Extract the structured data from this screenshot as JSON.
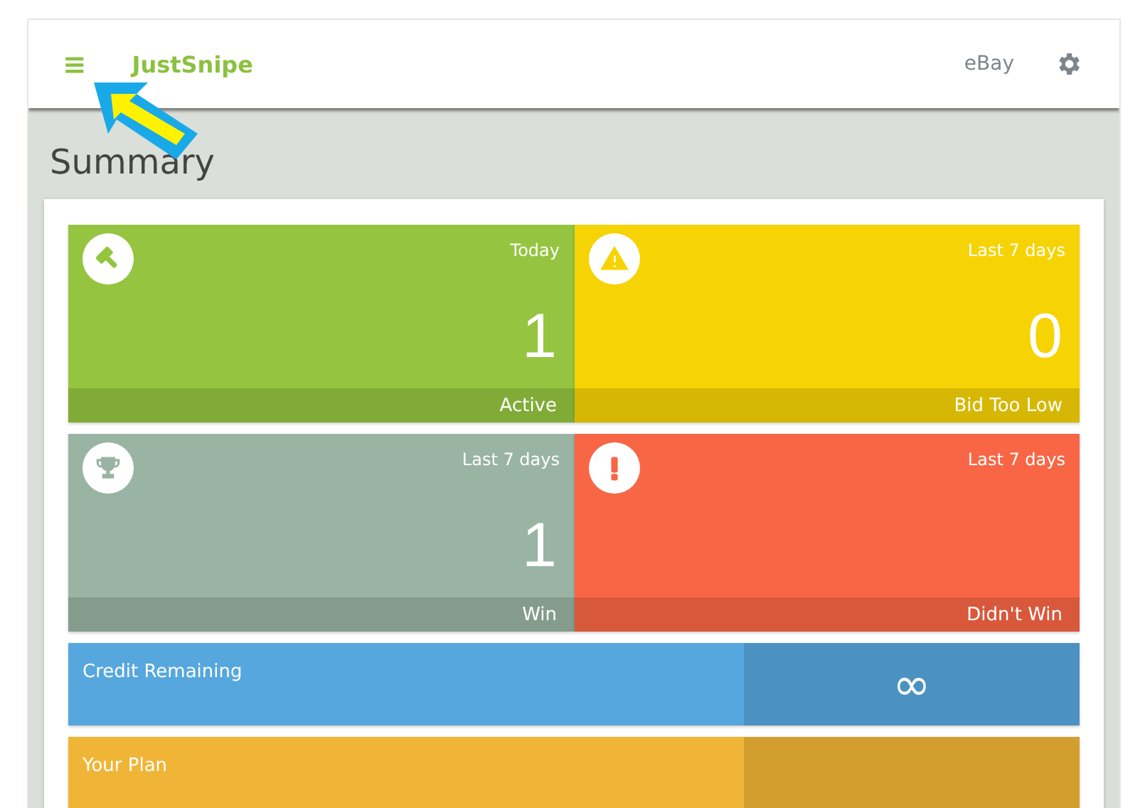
{
  "header": {
    "menu_icon": "≡",
    "brand": "JustSnipe",
    "links": [
      "eBay"
    ]
  },
  "page": {
    "title": "Summary"
  },
  "tiles": [
    {
      "kind": "gavel",
      "period": "Today",
      "value": "1",
      "label": "Active",
      "color": "#95c540"
    },
    {
      "kind": "warning",
      "period": "Last 7 days",
      "value": "0",
      "label": "Bid Too Low",
      "color": "#f6d304"
    },
    {
      "kind": "trophy",
      "period": "Last 7 days",
      "value": "1",
      "label": "Win",
      "color": "#99b4a3"
    },
    {
      "kind": "alert",
      "period": "Last 7 days",
      "label": "Didn't Win",
      "color": "#f86646"
    }
  ],
  "bars": [
    {
      "label": "Credit Remaining",
      "value": "∞",
      "color": "#56a7de"
    },
    {
      "label": "Your Plan",
      "color": "#f0b536"
    }
  ]
}
